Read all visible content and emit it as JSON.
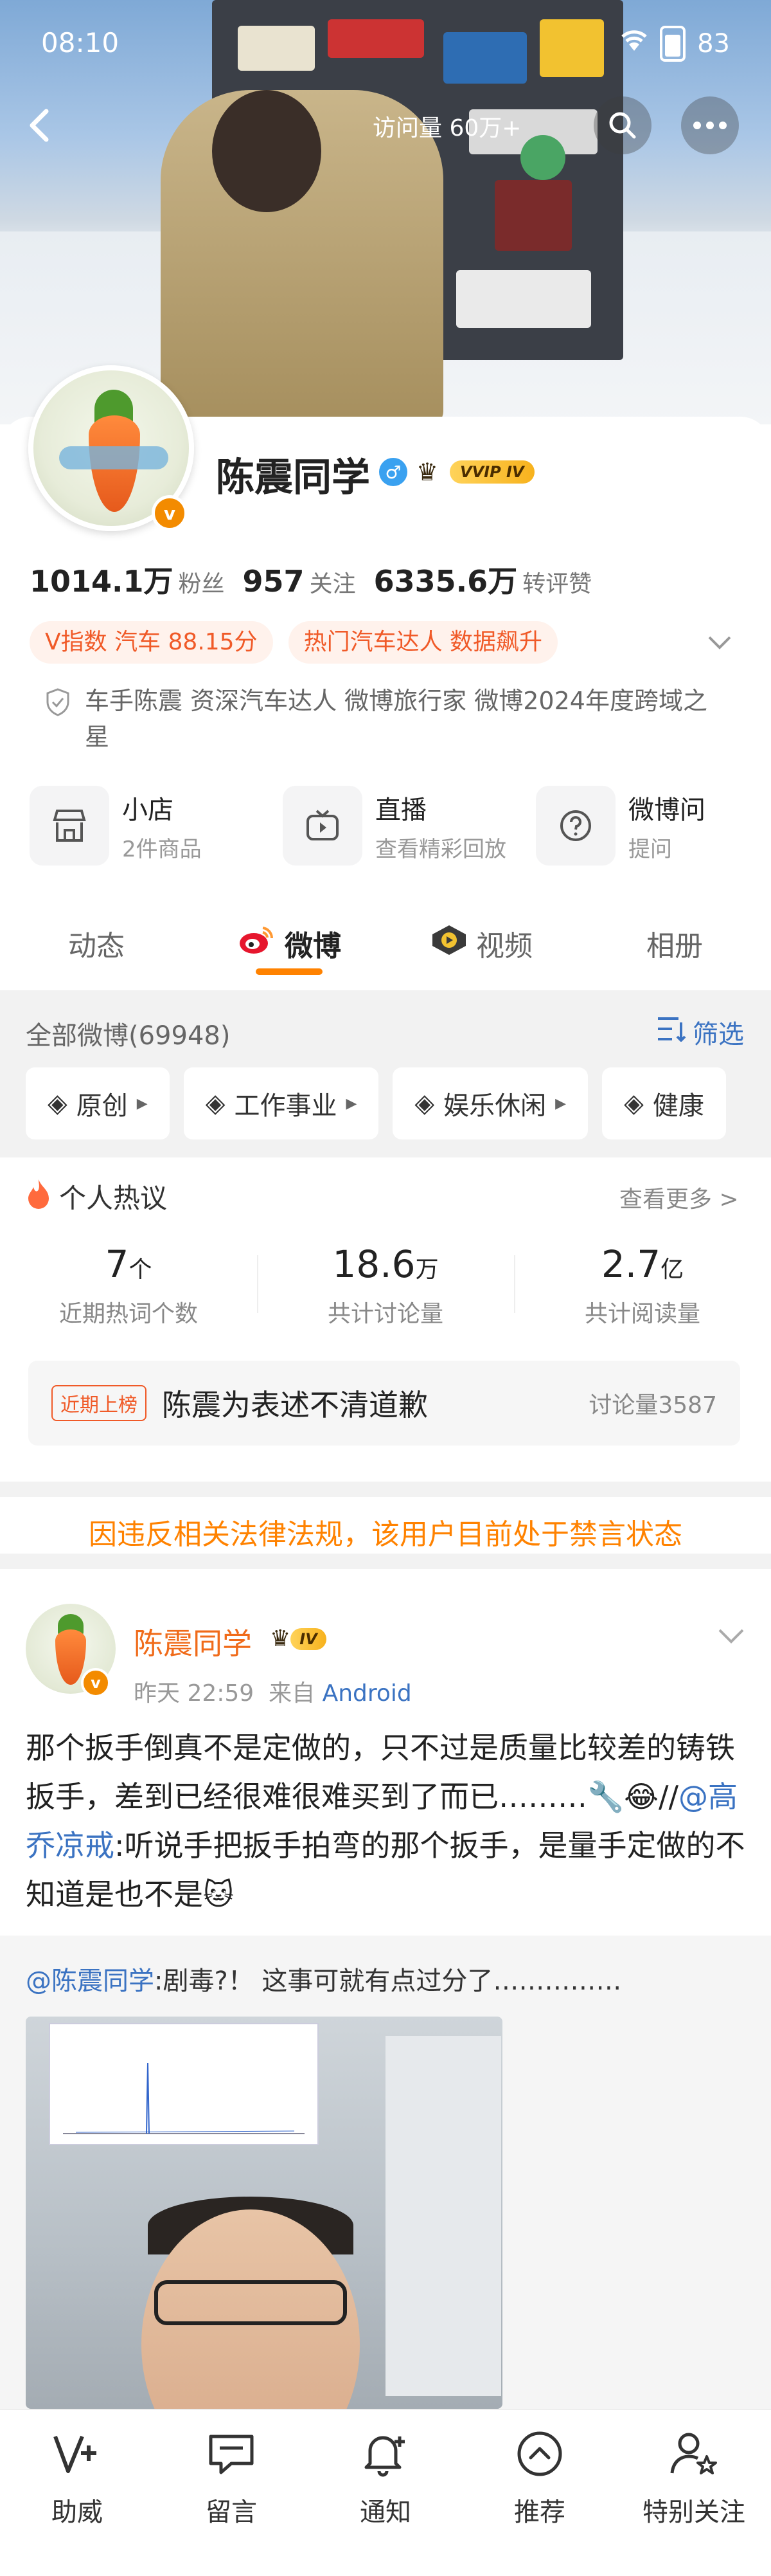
{
  "status_bar": {
    "time": "08:10",
    "battery": "83"
  },
  "header": {
    "visits": "访问量 60万+"
  },
  "profile": {
    "name": "陈震同学",
    "avatar_badge": "v",
    "vip_tag": "VVIP IV",
    "stats": [
      {
        "num": "1014.1万",
        "label": "粉丝"
      },
      {
        "num": "957",
        "label": "关注"
      },
      {
        "num": "6335.6万",
        "label": "转评赞"
      }
    ],
    "pills": [
      "V指数 汽车 88.15分",
      "热门汽车达人 数据飙升"
    ],
    "description": "车手陈震 资深汽车达人 微博旅行家 微博2024年度跨域之星",
    "services": [
      {
        "title": "小店",
        "sub": "2件商品"
      },
      {
        "title": "直播",
        "sub": "查看精彩回放"
      },
      {
        "title": "微博问",
        "sub": "提问"
      }
    ]
  },
  "tabs": [
    "动态",
    "微博",
    "视频",
    "相册"
  ],
  "feed": {
    "all_label": "全部微博(69948)",
    "filter_label": "筛选",
    "chips": [
      "原创",
      "工作事业",
      "娱乐休闲",
      "健康"
    ]
  },
  "hot": {
    "title": "个人热议",
    "more": "查看更多 >",
    "stats": [
      {
        "num": "7",
        "unit": "个",
        "label": "近期热词个数"
      },
      {
        "num": "18.6",
        "unit": "万",
        "label": "共计讨论量"
      },
      {
        "num": "2.7",
        "unit": "亿",
        "label": "共计阅读量"
      }
    ],
    "trend_tag": "近期上榜",
    "trend_text": "陈震为表述不清道歉",
    "trend_count": "讨论量3587"
  },
  "ban_notice": "因违反相关法律法规，该用户目前处于禁言状态",
  "post": {
    "author": "陈震同学",
    "badge": "IV",
    "time": "昨天 22:59",
    "from_label": "来自",
    "source": "Android",
    "body_part1": "那个扳手倒真不是定做的，只不过是质量比较差的铸铁扳手，差到已经很难很难买到了而已………🔧😂//",
    "mention": "@高乔凉戒",
    "body_part2": ":听说手把扳手拍弯的那个扳手，是量手定做的不知道是也不是🐱",
    "repost_mention": "@陈震同学",
    "repost_text": ":剧毒?！ 这事可就有点过分了……………"
  },
  "bottom_bar": [
    "助威",
    "留言",
    "通知",
    "推荐",
    "特别关注"
  ]
}
